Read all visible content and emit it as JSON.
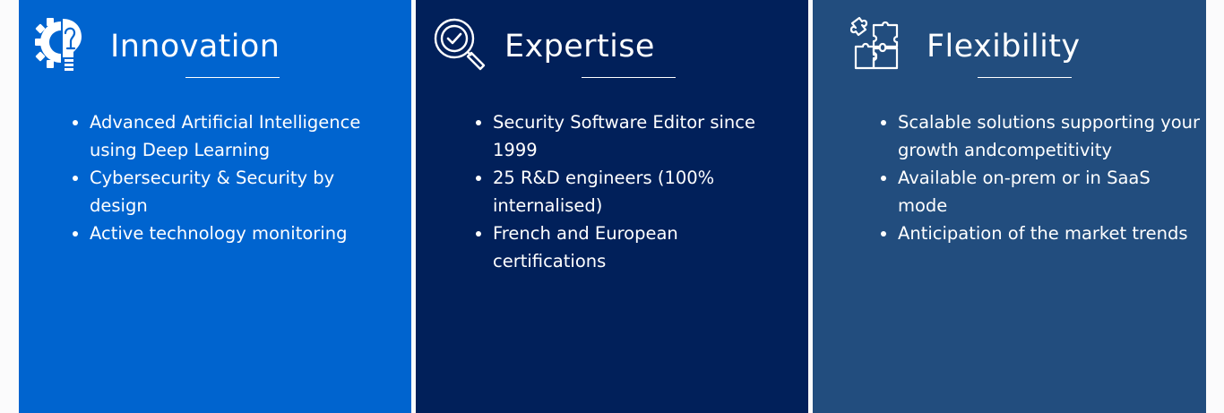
{
  "columns": [
    {
      "id": "innovation",
      "icon": "gear-lightbulb-icon",
      "title": "Innovation",
      "color": "#0064cf",
      "bullets": [
        "Advanced Artificial Intelligence using Deep Learning",
        "Cybersecurity & Security by design",
        "Active technology monitoring"
      ]
    },
    {
      "id": "expertise",
      "icon": "magnifier-check-icon",
      "title": "Expertise",
      "color": "#01205a",
      "bullets": [
        "Security Software Editor since 1999",
        "25 R&D engineers (100% internalised)",
        "French and European certifications"
      ]
    },
    {
      "id": "flexibility",
      "icon": "puzzle-icon",
      "title": "Flexibility",
      "color": "#224d7e",
      "bullets": [
        "Scalable solutions supporting your growth andcompetitivity",
        "Available on-prem or in SaaS mode",
        "Anticipation of the market trends"
      ]
    }
  ]
}
